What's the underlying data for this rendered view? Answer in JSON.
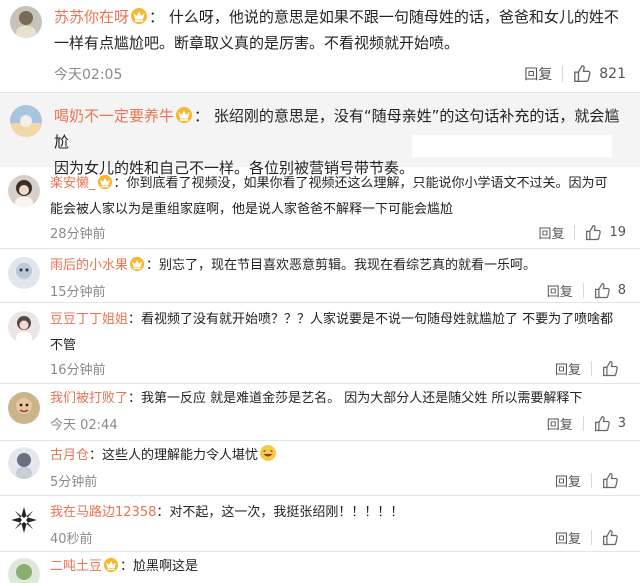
{
  "comments": [
    {
      "username": "苏苏你在呀",
      "lines": [
        "什么呀，他说的意思是如果不跟一句随母姓的话，爸爸和女儿的姓不",
        "一样有点尴尬吧。断章取义真的是厉害。不看视频就开始喷。"
      ],
      "time": "今天02:05",
      "reply_label": "回复",
      "likes": "821"
    },
    {
      "username": "喝奶不一定要养牛",
      "lines": [
        "张绍刚的意思是，没有“随母亲姓”的这句话补充的话，就会尴尬",
        "因为女儿的姓和自己不一样。各位别被营销号带节奏。"
      ]
    },
    {
      "username": "楽安懒_",
      "lines": [
        "你到底看了视频没，如果你看了视频还这么理解，只能说你小学语文不过关。因为可",
        "能会被人家以为是重组家庭啊，他是说人家爸爸不解释一下可能会尴尬"
      ],
      "time": "28分钟前",
      "reply_label": "回复",
      "likes": "19"
    },
    {
      "username": "雨后的小水果",
      "lines": [
        "别忘了，现在节目喜欢恶意剪辑。我现在看综艺真的就看一乐呵。"
      ],
      "time": "15分钟前",
      "reply_label": "回复",
      "likes": "8"
    },
    {
      "username": "豆豆丁丁姐姐",
      "lines": [
        "看视频了没有就开始喷？？？人家说要是不说一句随母姓就尴尬了 不要为了喷啥都",
        "不管"
      ],
      "time": "16分钟前",
      "reply_label": "回复",
      "likes": ""
    },
    {
      "username": "我们被打败了",
      "lines": [
        "我第一反应 就是难道金莎是艺名。 因为大部分人还是随父姓 所以需要解释下"
      ],
      "time": "今天 02:44",
      "reply_label": "回复",
      "likes": "3"
    },
    {
      "username": "古月仓",
      "lines": [
        "这些人的理解能力令人堪忧"
      ],
      "time": "5分钟前",
      "reply_label": "回复",
      "likes": ""
    },
    {
      "username": "我在马路边12358",
      "lines": [
        "对不起，这一次，我挺张绍刚！！！！！"
      ],
      "time": "40秒前",
      "reply_label": "回复",
      "likes": ""
    },
    {
      "username": "二吨土豆",
      "lines": [
        "尬黑啊这是"
      ]
    }
  ],
  "colon": "：",
  "icons": {
    "vip": "vip-badge-icon",
    "like": "thumbs-up-icon",
    "laugh": "laughing-emoji-icon"
  },
  "colors": {
    "username": "#eb7350",
    "meta": "#8a8a8a",
    "shaded_row": "#f4f4f4",
    "vip_gold": "#f0a020"
  }
}
